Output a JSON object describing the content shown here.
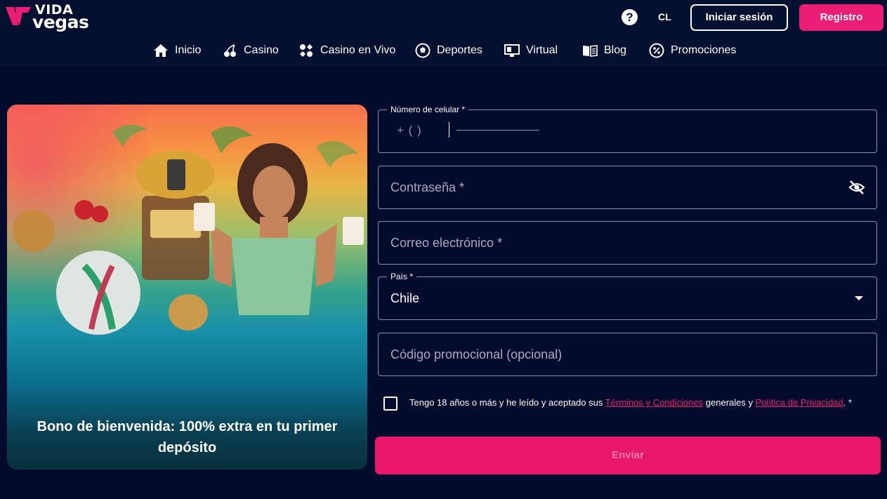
{
  "header": {
    "logo_top": "VIDA",
    "logo_bottom": "vegas",
    "help_label": "?",
    "language": "CL",
    "login_label": "Iniciar sesión",
    "register_label": "Registro"
  },
  "nav": {
    "items": [
      {
        "label": "Inicio",
        "icon": "home-icon"
      },
      {
        "label": "Casino",
        "icon": "cherry-icon"
      },
      {
        "label": "Casino en Vivo",
        "icon": "card-suits-icon"
      },
      {
        "label": "Deportes",
        "icon": "soccer-ball-icon"
      },
      {
        "label": "Virtual",
        "icon": "virtual-monitor-icon"
      },
      {
        "label": "Blog",
        "icon": "book-icon"
      },
      {
        "label": "Promociones",
        "icon": "percent-badge-icon"
      }
    ]
  },
  "promo": {
    "text": "Bono de bienvenida: 100% extra en tu primer depósito"
  },
  "form": {
    "phone": {
      "label": "Número de celular *",
      "prefix": "+ (     )"
    },
    "password": {
      "placeholder": "Contraseña *",
      "icon": "eye-off-icon"
    },
    "email": {
      "placeholder": "Correo electrónico *"
    },
    "country": {
      "label": "País *",
      "value": "Chile"
    },
    "promo_code": {
      "placeholder": "Código promocional (opcional)"
    },
    "terms": {
      "prefix": "Tengo 18 años o más y he leído y aceptado sus ",
      "terms_link": "Términos y Condiciones",
      "middle": " generales y ",
      "privacy_link": "Política de Privacidad",
      "suffix": ". *"
    },
    "submit_label": "Enviar"
  },
  "colors": {
    "background": "#020b2c",
    "accent": "#ec1d74",
    "border": "#8a93ac"
  }
}
